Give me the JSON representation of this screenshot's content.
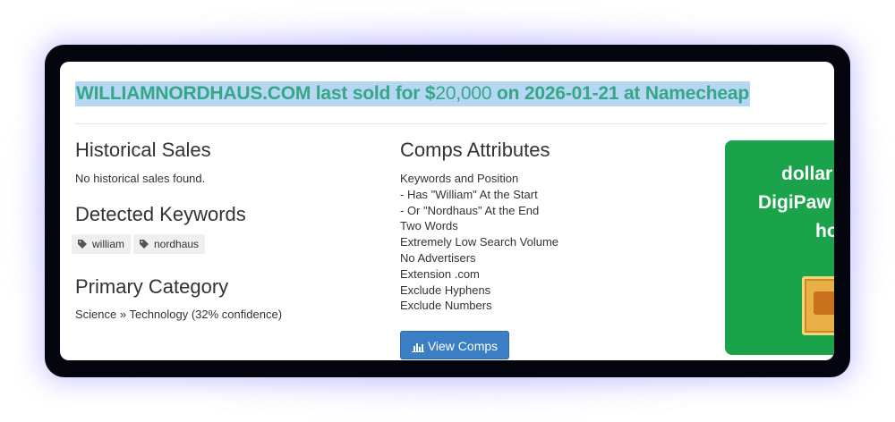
{
  "headline": {
    "part1": "WILLIAMNORDHAUS.COM last sold for $",
    "price": "20,000",
    "part2": " on 2026-01-21 at Namecheap"
  },
  "historical_sales": {
    "title": "Historical Sales",
    "empty_text": "No historical sales found."
  },
  "detected_keywords": {
    "title": "Detected Keywords",
    "tags": [
      "william",
      "nordhaus"
    ]
  },
  "primary_category": {
    "title": "Primary Category",
    "value": "Science » Technology (32% confidence)"
  },
  "comps_attributes": {
    "title": "Comps Attributes",
    "items": [
      "Keywords and Position",
      "- Has \"William\" At the Start",
      "- Or \"Nordhaus\" At the End",
      "Two Words",
      "Extremely Low Search Volume",
      "No Advertisers",
      "Extension .com",
      "Exclude Hyphens",
      "Exclude Numbers"
    ],
    "button_label": "View Comps"
  },
  "ad": {
    "lines": [
      "dollar",
      "DigiPaw",
      "ho"
    ],
    "color": "#1aa34a"
  },
  "colors": {
    "headline_text": "#36a786",
    "headline_highlight": "#b6d7f3",
    "button": "#3a7fc4"
  }
}
